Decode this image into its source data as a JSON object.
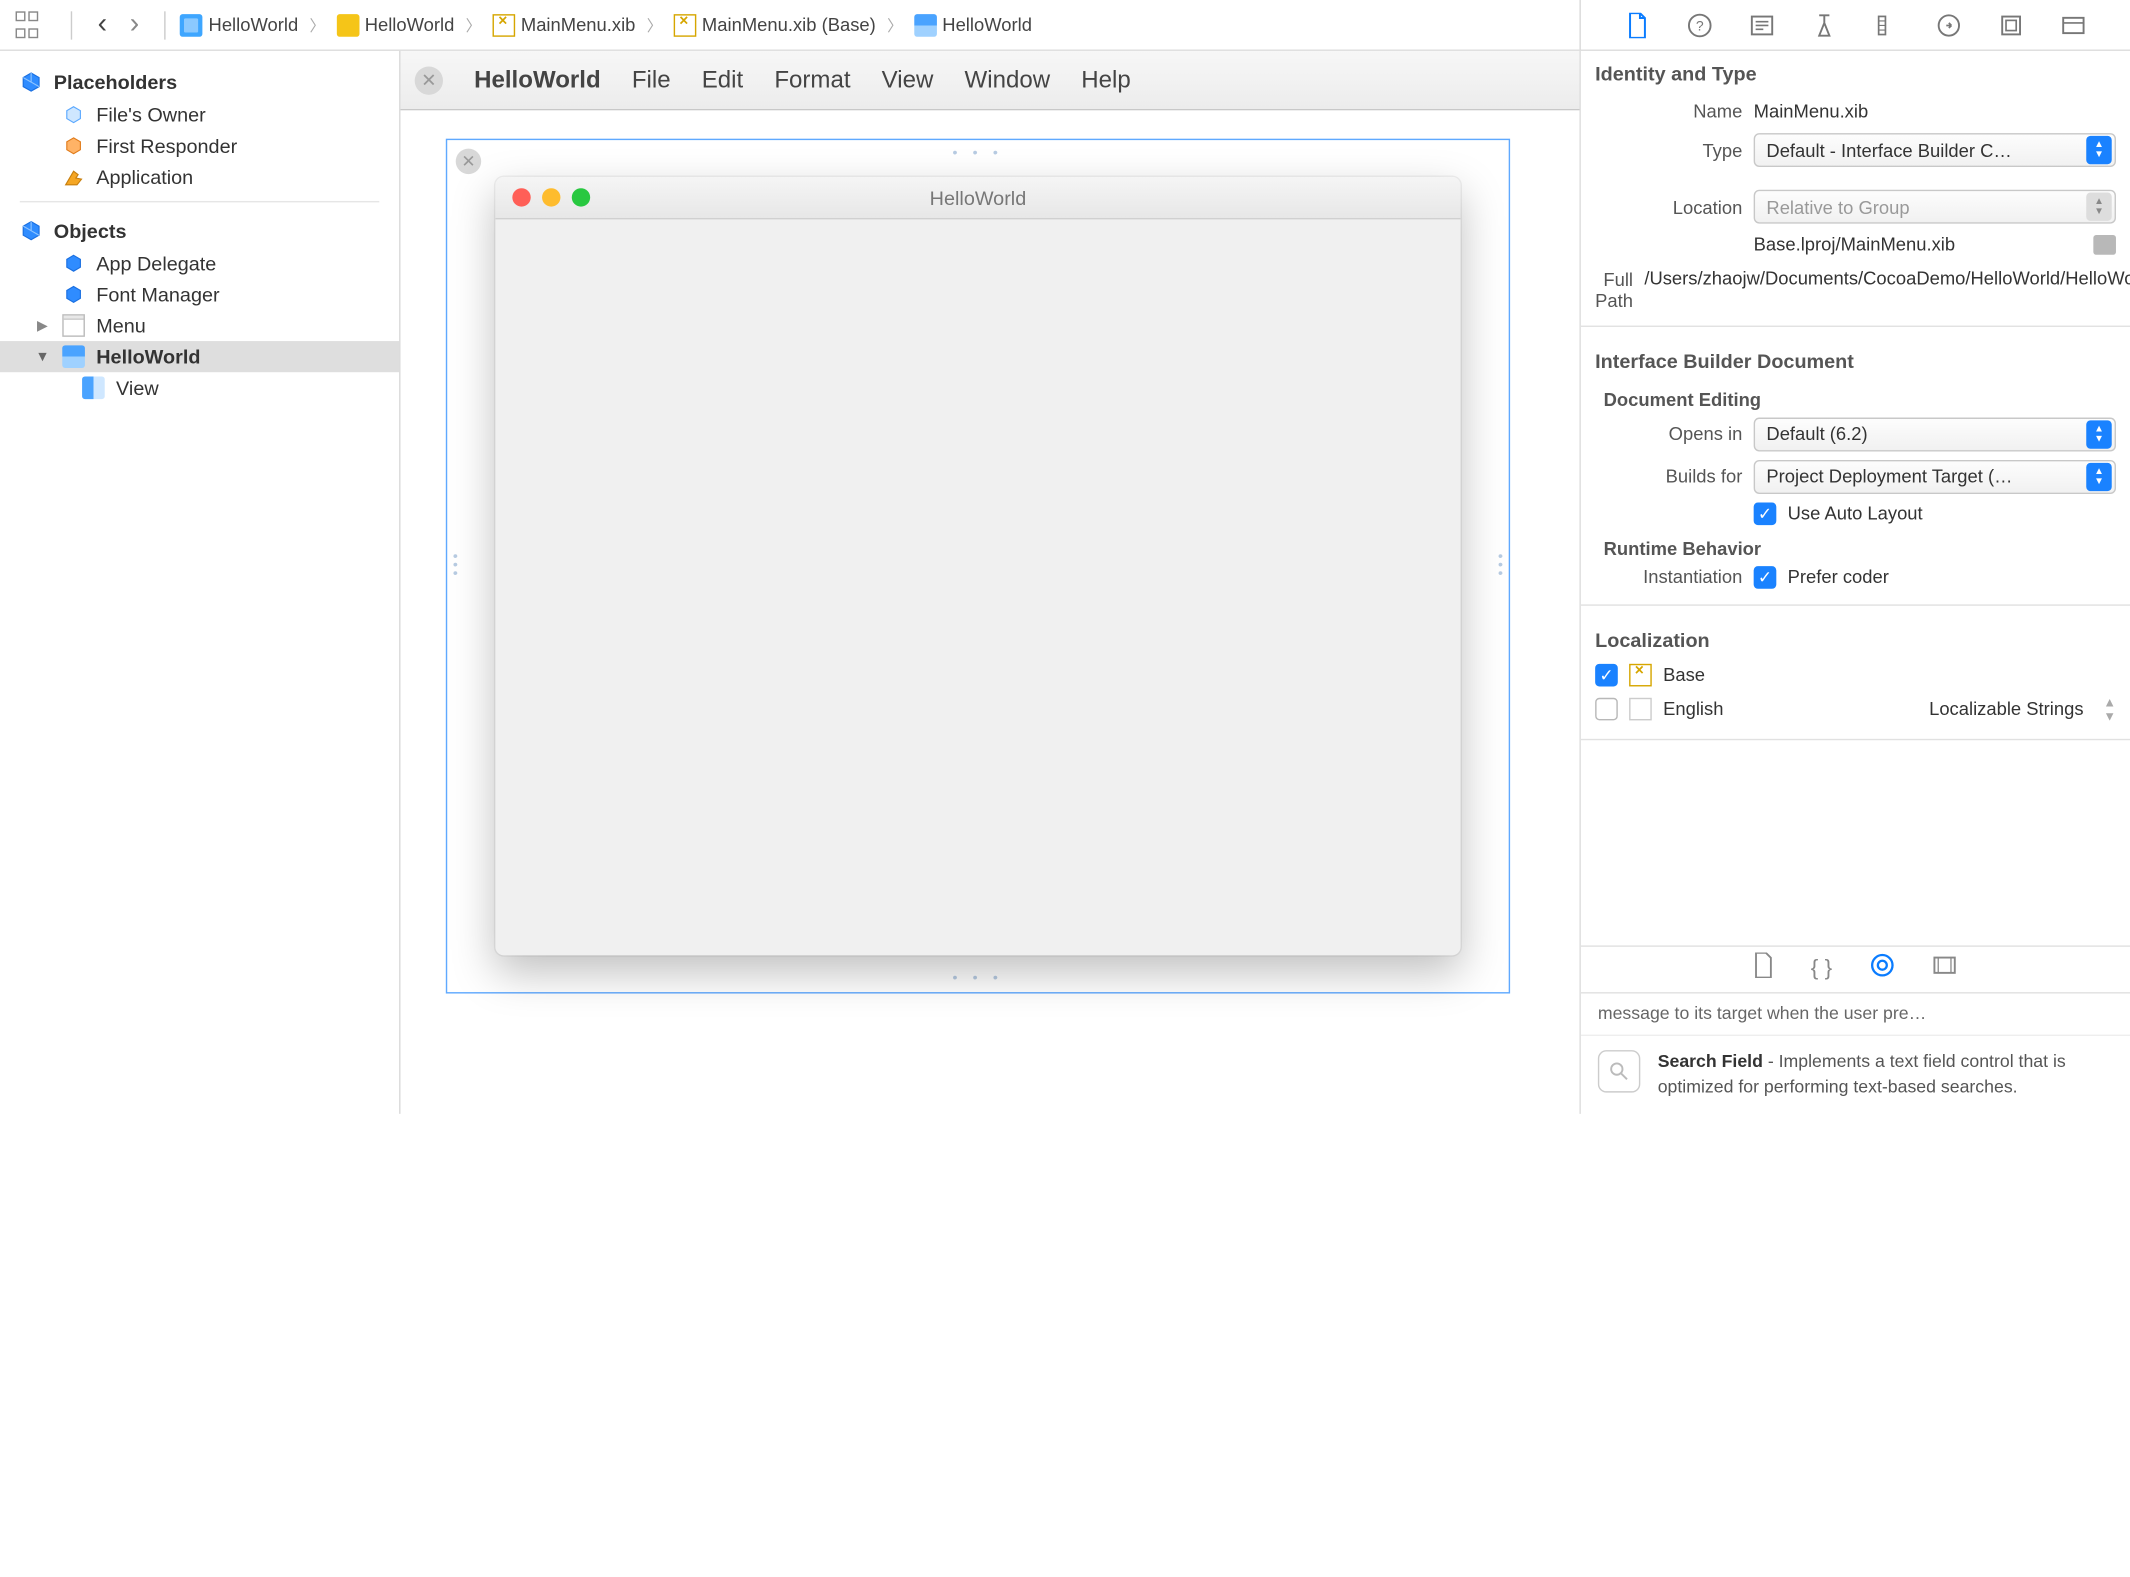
{
  "breadcrumb": [
    {
      "icon": "proj",
      "label": "HelloWorld"
    },
    {
      "icon": "folder",
      "label": "HelloWorld"
    },
    {
      "icon": "xib",
      "label": "MainMenu.xib"
    },
    {
      "icon": "xib",
      "label": "MainMenu.xib (Base)"
    },
    {
      "icon": "window",
      "label": "HelloWorld"
    }
  ],
  "outline": {
    "placeholders_hdr": "Placeholders",
    "placeholders": [
      {
        "icon": "cube-blue",
        "label": "File's Owner"
      },
      {
        "icon": "cube-orange",
        "label": "First Responder"
      },
      {
        "icon": "app",
        "label": "Application"
      }
    ],
    "objects_hdr": "Objects",
    "objects": [
      {
        "icon": "cube-blue",
        "label": "App Delegate"
      },
      {
        "icon": "cube-blue",
        "label": "Font Manager"
      },
      {
        "icon": "menu",
        "label": "Menu",
        "hasDisclosure": true
      },
      {
        "icon": "window",
        "label": "HelloWorld",
        "selected": true,
        "hasDisclosure": true,
        "open": true
      },
      {
        "icon": "view",
        "label": "View",
        "lvl": 2
      }
    ]
  },
  "menubar": {
    "app": "HelloWorld",
    "items": [
      "File",
      "Edit",
      "Format",
      "View",
      "Window",
      "Help"
    ]
  },
  "window_preview": {
    "title": "HelloWorld"
  },
  "inspector": {
    "section_identity": "Identity and Type",
    "name_lbl": "Name",
    "name_val": "MainMenu.xib",
    "type_lbl": "Type",
    "type_val": "Default - Interface Builder C…",
    "location_lbl": "Location",
    "location_val": "Relative to Group",
    "location_sub": "Base.lproj/MainMenu.xib",
    "fullpath_lbl": "Full Path",
    "fullpath_val": "/Users/zhaojw/Documents/CocoaDemo/HelloWorld/HelloWorld/Base.lproj/MainMenu.xib",
    "section_ibd": "Interface Builder Document",
    "doc_editing": "Document Editing",
    "opens_lbl": "Opens in",
    "opens_val": "Default (6.2)",
    "builds_lbl": "Builds for",
    "builds_val": "Project Deployment Target (…",
    "autolayout": "Use Auto Layout",
    "runtime": "Runtime Behavior",
    "instantiation_lbl": "Instantiation",
    "instantiation_val": "Prefer coder",
    "section_loc": "Localization",
    "loc_base": "Base",
    "loc_english": "English",
    "loc_english_kind": "Localizable Strings",
    "lib_truncated": "message to its target when the user pre…",
    "lib_search_title": "Search Field",
    "lib_search_body": " - Implements a text field control that is optimized for performing text-based searches."
  }
}
